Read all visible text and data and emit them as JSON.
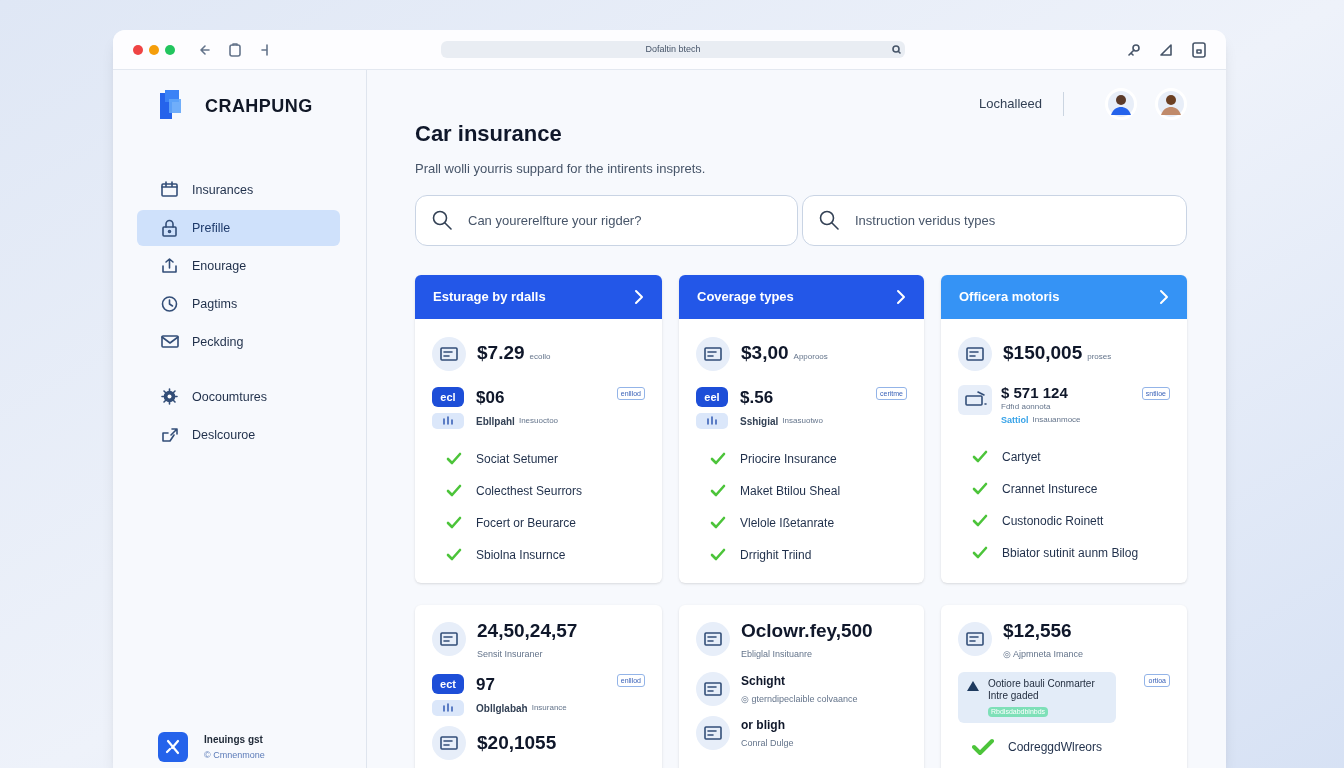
{
  "window": {
    "address": "Dofaltin btech"
  },
  "brand": "CRAHPUNG",
  "sidebar": {
    "items": [
      {
        "label": "Insurances",
        "selected": false
      },
      {
        "label": "Prefille",
        "selected": true
      },
      {
        "label": "Enourage",
        "selected": false
      },
      {
        "label": "Pagtims",
        "selected": false
      },
      {
        "label": "Peckding",
        "selected": false
      },
      {
        "label": "Oocoumtures",
        "selected": false
      },
      {
        "label": "Deslcouroe",
        "selected": false
      }
    ],
    "footer": {
      "title": "Ineuings gst",
      "subtitle": "© Cmnenmone"
    }
  },
  "header": {
    "user_label": "Lochalleed"
  },
  "title": "Car insurance",
  "subtitle": "Prall wolli yourris suppard for the intirents insprets.",
  "searches": [
    {
      "placeholder": "Can yourerelfture your rigder?"
    },
    {
      "placeholder": "Instruction veridus types"
    }
  ],
  "top_cards": [
    {
      "title": "Esturage by rdalls",
      "rows": [
        {
          "kind": "stat",
          "value": "$7.29",
          "note": "ecollo"
        },
        {
          "kind": "badge",
          "badge": "ecl",
          "value": "$06",
          "tag": "enlllod",
          "label": "Ebllpahl",
          "note": "Inesuoctoo"
        },
        {
          "kind": "check",
          "text": "Sociat Setumer"
        },
        {
          "kind": "check",
          "text": "Colecthest Seurrors"
        },
        {
          "kind": "check",
          "text": "Focert or Beurarce"
        },
        {
          "kind": "check",
          "text": "Sbiolna Insurnce"
        }
      ]
    },
    {
      "title": "Coverage types",
      "rows": [
        {
          "kind": "stat",
          "value": "$3,00",
          "note": "Apporoos"
        },
        {
          "kind": "badge",
          "badge": "eel",
          "value": "$.56",
          "tag": "ceritme",
          "label": "Sshigial",
          "note": "Insasuotwo"
        },
        {
          "kind": "check",
          "text": "Priocire Insurance"
        },
        {
          "kind": "check",
          "text": "Maket Btilou Sheal"
        },
        {
          "kind": "check",
          "text": "Vlelole Ißetanrate"
        },
        {
          "kind": "check",
          "text": "Drrighit Triind"
        }
      ]
    },
    {
      "title": "Officera motoris",
      "rows": [
        {
          "kind": "stat",
          "value": "$150,005",
          "note": "proses"
        },
        {
          "kind": "device",
          "value": "$ 571 124",
          "caption": "Fdfıd aonnota",
          "label": "Sattiol",
          "note": "Insauanmoce",
          "tag": "sntlioe"
        },
        {
          "kind": "check",
          "text": "Cartyet"
        },
        {
          "kind": "check",
          "text": "Crannet Insturece"
        },
        {
          "kind": "check",
          "text": "Custonodic Roinett"
        },
        {
          "kind": "check",
          "text": "Bbiator sutinit aunm Bilog"
        }
      ]
    }
  ],
  "bottom_cards": [
    {
      "rows": [
        {
          "kind": "stat",
          "value": "24,50,24,57",
          "caption": "Sensit Insuraner"
        },
        {
          "kind": "badge",
          "badge": "ect",
          "value": "97",
          "tag": "enlllod",
          "label": "Obllglabah",
          "note": "Insurance"
        },
        {
          "kind": "stat",
          "value": "$20,1055"
        }
      ]
    },
    {
      "rows": [
        {
          "kind": "stat",
          "value": "Oclowr.fey,500",
          "caption": "Ebliglal Insituanre"
        },
        {
          "kind": "line",
          "value": "Schight",
          "caption": "◎ gterndipeclaible colvaance"
        },
        {
          "kind": "line",
          "value": "or bligh",
          "caption": "Conral Dulge"
        }
      ]
    },
    {
      "rows": [
        {
          "kind": "stat",
          "value": "$12,556",
          "caption": "◎ Ajpmneta Imance"
        },
        {
          "kind": "alert",
          "text": "Ootiore bauli Conmarter Intre gaded",
          "pill": "Rbdlsdabdblnbds",
          "tag": "ortioa"
        },
        {
          "kind": "check",
          "text": "CodreggdWlreors"
        }
      ]
    }
  ]
}
